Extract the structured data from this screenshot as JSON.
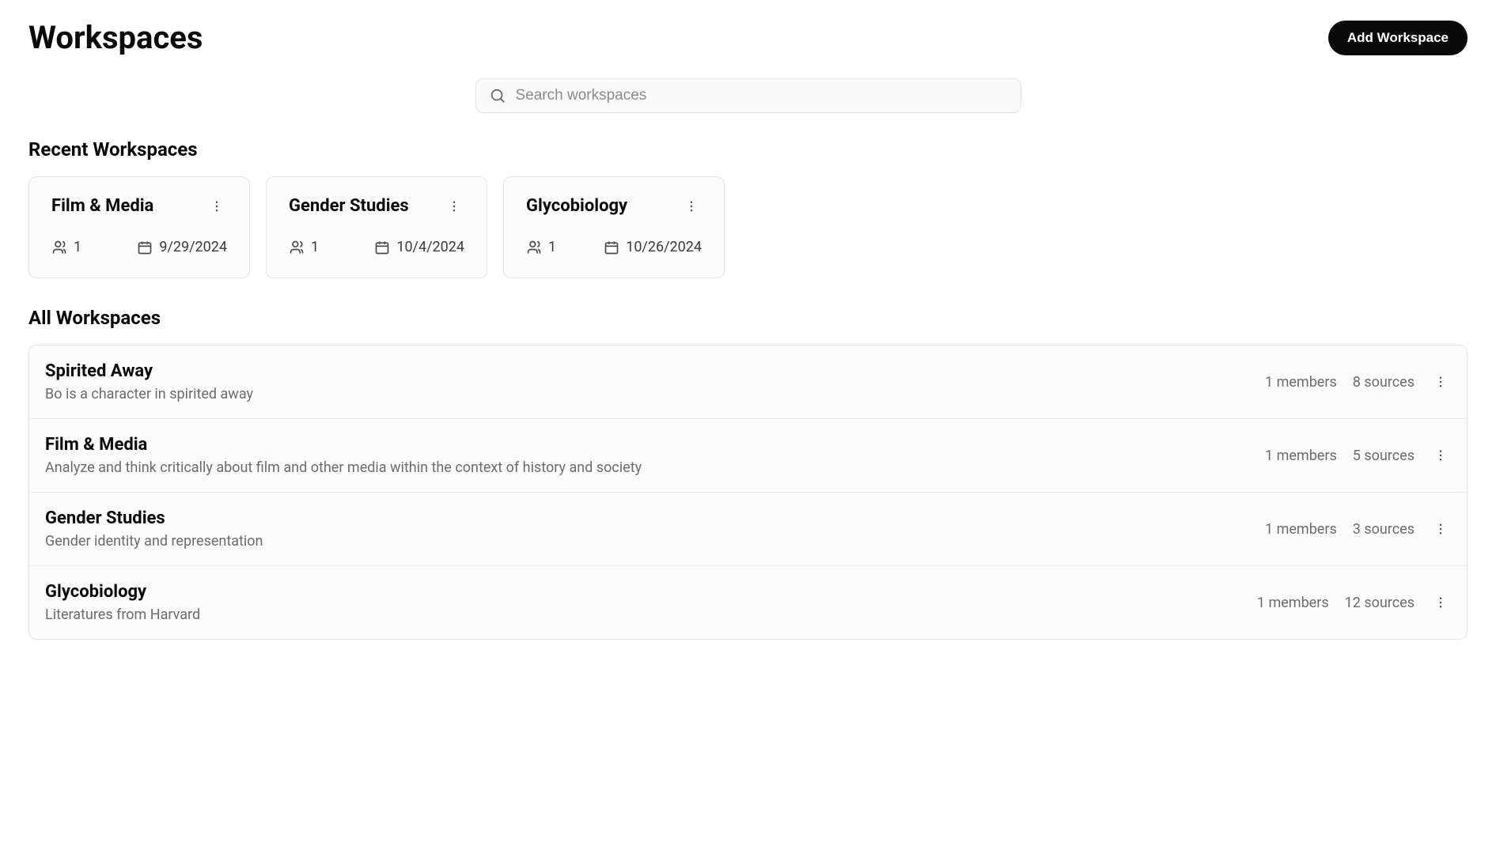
{
  "header": {
    "title": "Workspaces",
    "add_button": "Add Workspace"
  },
  "search": {
    "placeholder": "Search workspaces"
  },
  "sections": {
    "recent_title": "Recent Workspaces",
    "all_title": "All Workspaces"
  },
  "recent": [
    {
      "title": "Film & Media",
      "members": "1",
      "date": "9/29/2024"
    },
    {
      "title": "Gender Studies",
      "members": "1",
      "date": "10/4/2024"
    },
    {
      "title": "Glycobiology",
      "members": "1",
      "date": "10/26/2024"
    }
  ],
  "all": [
    {
      "title": "Spirited Away",
      "desc": "Bo is a character in spirited away",
      "members": "1 members",
      "sources": "8 sources"
    },
    {
      "title": "Film & Media",
      "desc": "Analyze and think critically about film and other media within the context of history and society",
      "members": "1 members",
      "sources": "5 sources"
    },
    {
      "title": "Gender Studies",
      "desc": "Gender identity and representation",
      "members": "1 members",
      "sources": "3 sources"
    },
    {
      "title": "Glycobiology",
      "desc": "Literatures from Harvard",
      "members": "1 members",
      "sources": "12 sources"
    }
  ]
}
